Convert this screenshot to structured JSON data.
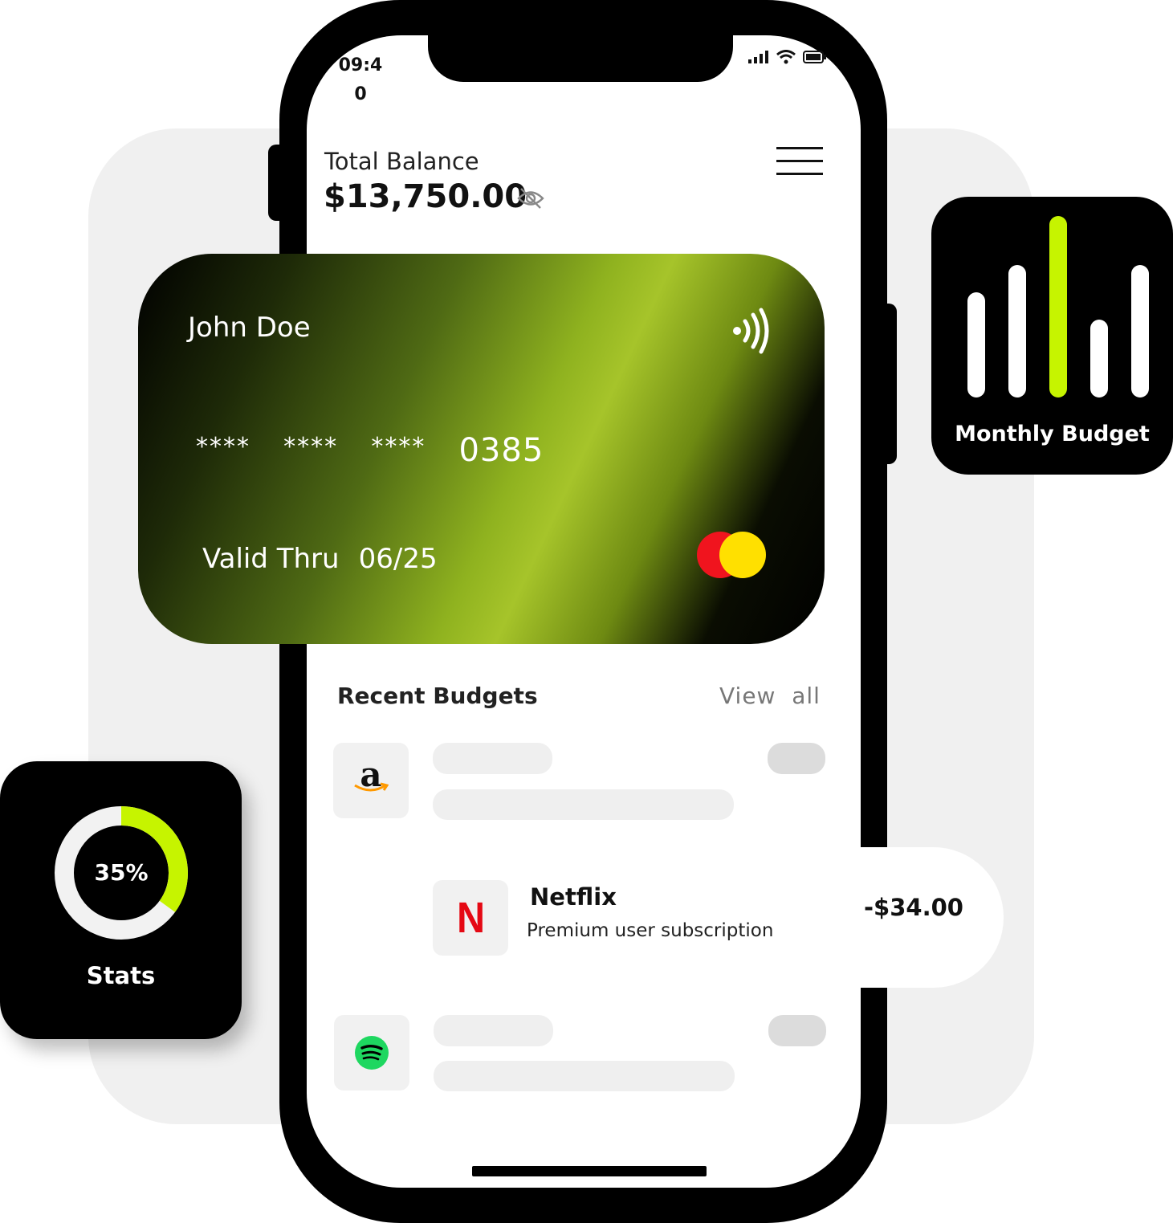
{
  "status_bar": {
    "time": "09:40"
  },
  "balance": {
    "label": "Total Balance",
    "amount": "$13,750.00"
  },
  "card": {
    "holder": "John Doe",
    "masked_groups": [
      "****",
      "****",
      "****"
    ],
    "last4": "0385",
    "valid_label": "Valid Thru",
    "expiry": "06/25"
  },
  "recent_budgets": {
    "title": "Recent Budgets",
    "view_all": "View  all",
    "items": [
      {
        "merchant_icon": "amazon-icon",
        "logo_text": "a"
      },
      {
        "merchant_icon": "netflix-icon",
        "logo_text": "N",
        "name": "Netflix",
        "description": "Premium user subscription",
        "amount": "-$34.00"
      },
      {
        "merchant_icon": "spotify-icon"
      }
    ]
  },
  "monthly_budget_widget": {
    "label": "Monthly Budget",
    "bars": [
      {
        "level": 0.58,
        "highlighted": false
      },
      {
        "level": 0.73,
        "highlighted": false
      },
      {
        "level": 1.0,
        "highlighted": true
      },
      {
        "level": 0.43,
        "highlighted": false
      },
      {
        "level": 0.73,
        "highlighted": false
      }
    ]
  },
  "stats_widget": {
    "label": "Stats",
    "percent_text": "35%",
    "percent": 35
  },
  "colors": {
    "accent": "#c6f400",
    "background_panel": "#f0f0f0",
    "netflix_red": "#e50914",
    "spotify_green": "#1ed760",
    "mastercard_red": "#f0141e",
    "mastercard_yellow": "#ffe000"
  }
}
